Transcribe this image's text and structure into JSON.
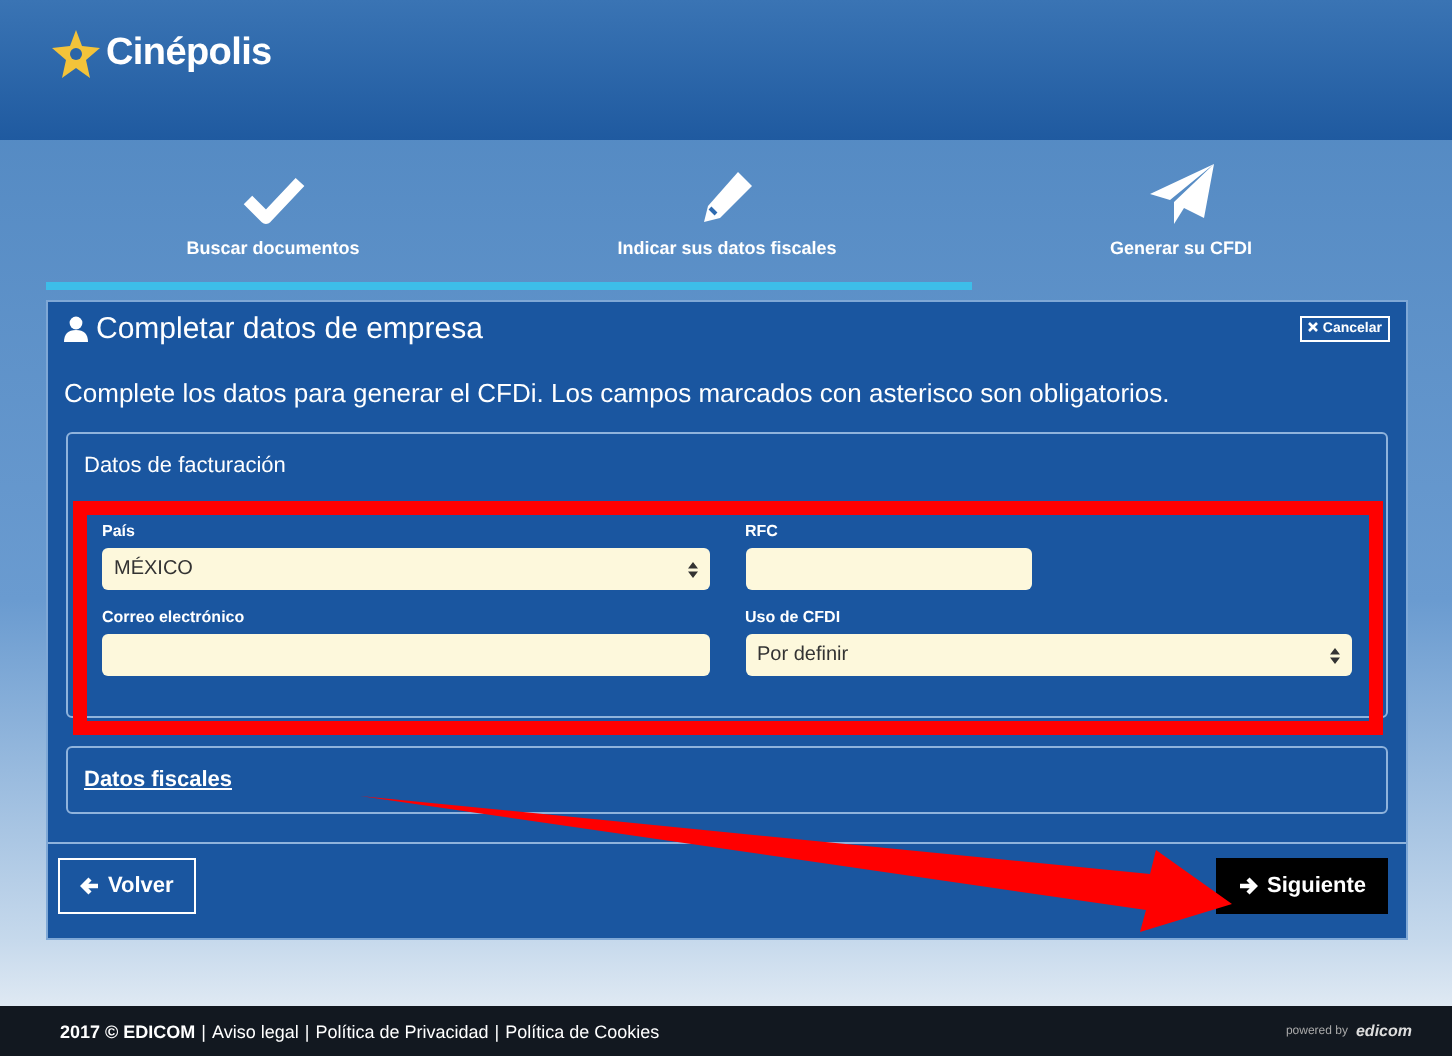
{
  "header": {
    "logo_text": "Cinépolis"
  },
  "steps": {
    "items": [
      {
        "label": "Buscar documentos",
        "kind": "check"
      },
      {
        "label": "Indicar sus datos fiscales",
        "kind": "pencil"
      },
      {
        "label": "Generar su CFDI",
        "kind": "plane"
      }
    ],
    "level": 0.68
  },
  "panel": {
    "title": "Completar datos de empresa",
    "cancel": "Cancelar",
    "intro": "Complete los datos para generar el CFDi. Los campos marcados con asterisco son obligatorios.",
    "sections": [
      {
        "title": "Datos de facturación",
        "expanded": true,
        "fields": [
          {
            "label": "País",
            "kind": "select",
            "value": "MÉXICO"
          },
          {
            "label": "RFC",
            "kind": "short_text"
          },
          {
            "label": "Correo electrónico",
            "kind": "text"
          },
          {
            "label": "Uso de CFDI",
            "kind": "select",
            "value": "Por definir"
          }
        ]
      },
      {
        "title": "Datos fiscales",
        "expanded": false
      }
    ],
    "back": "Volver",
    "next": "Siguiente"
  },
  "footer": {
    "links": [
      {
        "text": "2017 © EDICOM",
        "kind": "brand"
      },
      {
        "text": "Aviso legal",
        "kind": "link"
      },
      {
        "text": "Política de Privacidad",
        "kind": "link"
      },
      {
        "text": "Política de Cookies",
        "kind": "link"
      }
    ],
    "separator": "|",
    "powered_label": "powered by",
    "powered_brand": "edicom"
  }
}
